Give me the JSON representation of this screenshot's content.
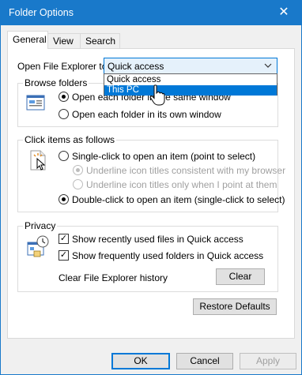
{
  "window": {
    "title": "Folder Options",
    "close_glyph": "✕"
  },
  "tabs": [
    {
      "label": "General"
    },
    {
      "label": "View"
    },
    {
      "label": "Search"
    }
  ],
  "open_with": {
    "label": "Open File Explorer to:",
    "value": "Quick access",
    "options": [
      "Quick access",
      "This PC"
    ],
    "highlighted_option": "This PC"
  },
  "browse": {
    "title": "Browse folders",
    "options": [
      {
        "label": "Open each folder in the same window",
        "checked": true
      },
      {
        "label": "Open each folder in its own window",
        "checked": false
      }
    ]
  },
  "click": {
    "title": "Click items as follows",
    "single": "Single-click to open an item (point to select)",
    "underline_consistent": "Underline icon titles consistent with my browser",
    "underline_point": "Underline icon titles only when I point at them",
    "double": "Double-click to open an item (single-click to select)"
  },
  "privacy": {
    "title": "Privacy",
    "recent_files": "Show recently used files in Quick access",
    "frequent_folders": "Show frequently used folders in Quick access",
    "clear_label": "Clear File Explorer history",
    "clear_button": "Clear"
  },
  "restore_defaults": "Restore Defaults",
  "footer": {
    "ok": "OK",
    "cancel": "Cancel",
    "apply": "Apply"
  },
  "check_glyph": "✓",
  "colors": {
    "titlebar": "#1979ca",
    "accent": "#0078d7"
  }
}
